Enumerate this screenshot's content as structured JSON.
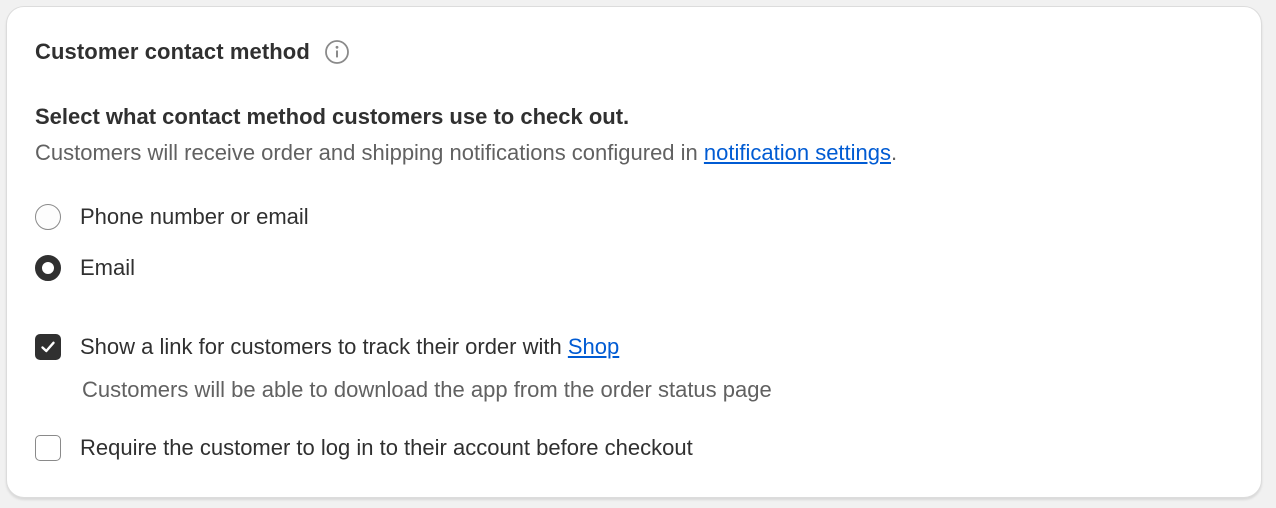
{
  "card": {
    "title": "Customer contact method",
    "info_icon": "info-circle-icon",
    "description_strong": "Select what contact method customers use to check out.",
    "description_text": "Customers will receive order and shipping notifications configured in ",
    "description_link": "notification settings",
    "description_end": "."
  },
  "contact_options": [
    {
      "label": "Phone number or email",
      "selected": false
    },
    {
      "label": "Email",
      "selected": true
    }
  ],
  "checkboxes": {
    "shop_link": {
      "label": "Show a link for customers to track their order with ",
      "link": "Shop",
      "checked": true,
      "help_text": "Customers will be able to download the app from the order status page"
    },
    "require_login": {
      "label": "Require the customer to log in to their account before checkout",
      "checked": false
    }
  },
  "colors": {
    "link": "#005bd3",
    "text": "#303030",
    "subdued": "#616161"
  }
}
